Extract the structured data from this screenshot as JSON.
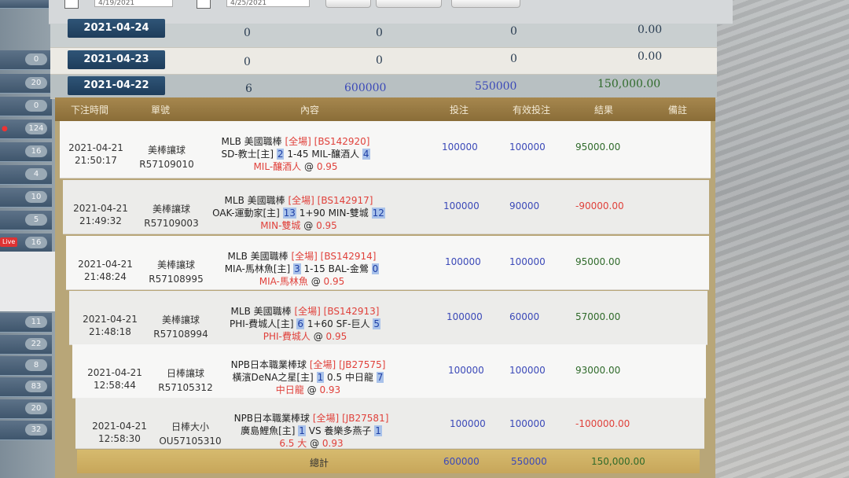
{
  "toolbar": {
    "date_from": "4/19/2021",
    "date_to": "4/25/2021"
  },
  "sidebar": {
    "badges": [
      "0",
      "20",
      "0",
      "124",
      "16",
      "4",
      "10",
      "5",
      "16",
      "11",
      "22",
      "8",
      "83",
      "20",
      "32"
    ],
    "live_label": "Live"
  },
  "summary_rows": [
    {
      "date": "2021-04-24",
      "count": "0",
      "stake": "0",
      "valid": "0",
      "result": "0.00"
    },
    {
      "date": "2021-04-23",
      "count": "0",
      "stake": "0",
      "valid": "0",
      "result": "0.00"
    },
    {
      "date": "2021-04-22",
      "count": "6",
      "stake": "600000",
      "valid": "550000",
      "result": "150,000.00"
    }
  ],
  "table": {
    "headers": {
      "time": "下注時間",
      "ticket": "單號",
      "content": "內容",
      "stake": "投注",
      "valid": "有效投注",
      "result": "結果",
      "note": "備註"
    },
    "rows": [
      {
        "date": "2021-04-21",
        "time": "21:50:17",
        "type": "美棒讓球",
        "ticket": "R57109010",
        "league": "MLB 美國職棒",
        "period": "[全場]",
        "code": "[BS142920]",
        "home": "SD-教士[主]",
        "home_score": "2",
        "line": "1-45",
        "away": "MIL-釀酒人",
        "away_score": "4",
        "pick": "MIL-釀酒人",
        "at": "@",
        "odds": "0.95",
        "stake": "100000",
        "valid": "100000",
        "result": "95000.00",
        "result_sign": "pos"
      },
      {
        "date": "2021-04-21",
        "time": "21:49:32",
        "type": "美棒讓球",
        "ticket": "R57109003",
        "league": "MLB 美國職棒",
        "period": "[全場]",
        "code": "[BS142917]",
        "home": "OAK-運動家[主]",
        "home_score": "13",
        "line": "1+90",
        "away": "MIN-雙城",
        "away_score": "12",
        "pick": "MIN-雙城",
        "at": "@",
        "odds": "0.95",
        "stake": "100000",
        "valid": "90000",
        "result": "-90000.00",
        "result_sign": "neg"
      },
      {
        "date": "2021-04-21",
        "time": "21:48:24",
        "type": "美棒讓球",
        "ticket": "R57108995",
        "league": "MLB 美國職棒",
        "period": "[全場]",
        "code": "[BS142914]",
        "home": "MIA-馬林魚[主]",
        "home_score": "3",
        "line": "1-15",
        "away": "BAL-金鶯",
        "away_score": "0",
        "pick": "MIA-馬林魚",
        "at": "@",
        "odds": "0.95",
        "stake": "100000",
        "valid": "100000",
        "result": "95000.00",
        "result_sign": "pos"
      },
      {
        "date": "2021-04-21",
        "time": "21:48:18",
        "type": "美棒讓球",
        "ticket": "R57108994",
        "league": "MLB 美國職棒",
        "period": "[全場]",
        "code": "[BS142913]",
        "home": "PHI-費城人[主]",
        "home_score": "6",
        "line": "1+60",
        "away": "SF-巨人",
        "away_score": "5",
        "pick": "PHI-費城人",
        "at": "@",
        "odds": "0.95",
        "stake": "100000",
        "valid": "60000",
        "result": "57000.00",
        "result_sign": "pos"
      },
      {
        "date": "2021-04-21",
        "time": "12:58:44",
        "type": "日棒讓球",
        "ticket": "R57105312",
        "league": "NPB日本職業棒球",
        "period": "[全場]",
        "code": "[JB27575]",
        "home": "橫濱DeNA之星[主]",
        "home_score": "1",
        "line": "0.5",
        "away": "中日龍",
        "away_score": "7",
        "pick": "中日龍",
        "at": "@",
        "odds": "0.93",
        "stake": "100000",
        "valid": "100000",
        "result": "93000.00",
        "result_sign": "pos"
      },
      {
        "date": "2021-04-21",
        "time": "12:58:30",
        "type": "日棒大小",
        "ticket": "OU57105310",
        "league": "NPB日本職業棒球",
        "period": "[全場]",
        "code": "[JB27581]",
        "home": "廣島鯉魚[主]",
        "home_score": "1",
        "line": "VS",
        "away": "養樂多燕子",
        "away_score": "1",
        "pick": "6.5 大",
        "at": "@",
        "odds": "0.93",
        "stake": "100000",
        "valid": "100000",
        "result": "-100000.00",
        "result_sign": "neg"
      }
    ],
    "total": {
      "label": "總計",
      "stake": "600000",
      "valid": "550000",
      "result": "150,000.00"
    }
  },
  "colors": {
    "header_bg": "#9a7b43",
    "date_button": "#24476a",
    "positive": "#2f6a2a",
    "negative": "#e0413b",
    "highlight": "#a9c2ea"
  }
}
